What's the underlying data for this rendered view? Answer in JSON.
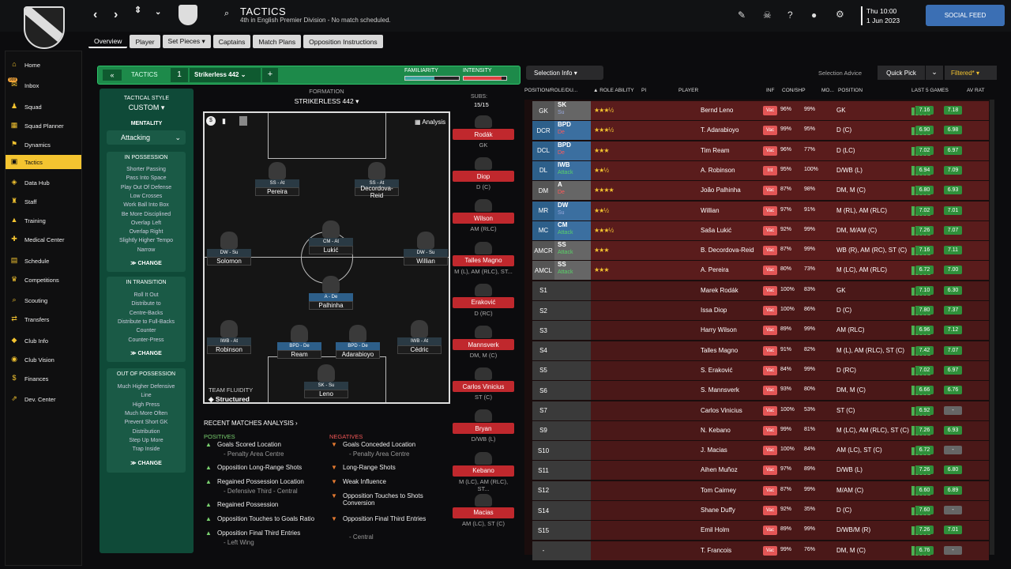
{
  "header": {
    "title": "TACTICS",
    "subtitle": "4th in English Premier Division - No match scheduled.",
    "time": "Thu 10:00",
    "date": "1 Jun 2023",
    "social_feed": "SOCIAL FEED"
  },
  "sidebar": [
    {
      "label": "Home",
      "icon": "home-icon"
    },
    {
      "label": "Inbox",
      "icon": "inbox-icon",
      "badge": "999"
    },
    {
      "label": "Squad",
      "icon": "squad-icon"
    },
    {
      "label": "Squad Planner",
      "icon": "planner-icon"
    },
    {
      "label": "Dynamics",
      "icon": "dynamics-icon"
    },
    {
      "label": "Tactics",
      "icon": "tactics-icon",
      "active": true
    },
    {
      "label": "Data Hub",
      "icon": "datahub-icon"
    },
    {
      "label": "Staff",
      "icon": "staff-icon"
    },
    {
      "label": "Training",
      "icon": "training-icon"
    },
    {
      "label": "Medical Center",
      "icon": "medical-icon"
    },
    {
      "label": "Schedule",
      "icon": "schedule-icon"
    },
    {
      "label": "Competitions",
      "icon": "trophy-icon"
    },
    {
      "label": "Scouting",
      "icon": "scouting-icon"
    },
    {
      "label": "Transfers",
      "icon": "transfers-icon"
    },
    {
      "label": "Club Info",
      "icon": "clubinfo-icon"
    },
    {
      "label": "Club Vision",
      "icon": "vision-icon"
    },
    {
      "label": "Finances",
      "icon": "finances-icon"
    },
    {
      "label": "Dev. Center",
      "icon": "devcenter-icon"
    }
  ],
  "tabs": [
    "Overview",
    "Player",
    "Set Pieces ▾",
    "Captains",
    "Match Plans",
    "Opposition Instructions"
  ],
  "tactic_bar": {
    "label": "TACTICS",
    "slot": "1",
    "name": "Strikerless 442",
    "familiarity": "FAMILIARITY",
    "intensity": "INTENSITY"
  },
  "style": {
    "heading": "TACTICAL STYLE",
    "value": "CUSTOM ▾",
    "mentality_label": "MENTALITY",
    "mentality": "Attacking",
    "in_possession": {
      "title": "IN POSSESSION",
      "items": [
        "Shorter Passing",
        "Pass Into Space",
        "Play Out Of Defense",
        "Low Crosses",
        "Work Ball Into Box",
        "Be More Disciplined",
        "Overlap Left",
        "Overlap Right",
        "Slightly Higher Tempo",
        "Narrow"
      ]
    },
    "in_transition": {
      "title": "IN TRANSITION",
      "items": [
        "Roll It Out",
        "Distribute to",
        "Centre-Backs",
        "Distribute to Full-Backs",
        "Counter",
        "Counter-Press"
      ]
    },
    "out_of_possession": {
      "title": "OUT OF POSSESSION",
      "items": [
        "Much Higher Defensive",
        "Line",
        "High Press",
        "Much More Often",
        "Prevent Short GK",
        "Distribution",
        "Step Up More",
        "Trap Inside"
      ]
    },
    "change": "CHANGE"
  },
  "formation": {
    "label": "FORMATION",
    "name": "STRIKERLESS 442 ▾",
    "analysis": "Analysis",
    "fluidity_label": "TEAM FLUIDITY",
    "fluidity": "Structured"
  },
  "pitch_players": [
    {
      "role": "SS - At",
      "name": "Pereira"
    },
    {
      "role": "SS - At",
      "name": "Decordova-Reid"
    },
    {
      "role": "DW - Su",
      "name": "Solomon"
    },
    {
      "role": "CM - At",
      "name": "Lukić"
    },
    {
      "role": "DW - Su",
      "name": "Willian"
    },
    {
      "role": "A - De",
      "name": "Palhinha"
    },
    {
      "role": "IWB - At",
      "name": "Robinson"
    },
    {
      "role": "BPD - De",
      "name": "Ream"
    },
    {
      "role": "BPD - De",
      "name": "Adarabioyo"
    },
    {
      "role": "IWB - At",
      "name": "Cédric"
    },
    {
      "role": "SK - Su",
      "name": "Leno"
    }
  ],
  "subs": {
    "label": "SUBS:",
    "count": "15/15",
    "players": [
      {
        "name": "Rodák",
        "pos": "GK"
      },
      {
        "name": "Diop",
        "pos": "D (C)"
      },
      {
        "name": "Wilson",
        "pos": "AM (RLC)"
      },
      {
        "name": "Talles Magno",
        "pos": "M (L), AM (RLC), ST..."
      },
      {
        "name": "Eraković",
        "pos": "D (RC)"
      },
      {
        "name": "Mannsverk",
        "pos": "DM, M (C)"
      },
      {
        "name": "Carlos Vinicius",
        "pos": "ST (C)"
      },
      {
        "name": "Bryan",
        "pos": "D/WB (L)"
      },
      {
        "name": "Kebano",
        "pos": "M (LC), AM (RLC), ST..."
      },
      {
        "name": "Macias",
        "pos": "AM (LC), ST (C)"
      }
    ]
  },
  "analysis": {
    "title": "RECENT MATCHES ANALYSIS ›",
    "positives_label": "POSITIVES",
    "negatives_label": "NEGATIVES",
    "positives": [
      {
        "t": "Goals Scored Location",
        "s": "- Penalty Area Centre"
      },
      {
        "t": "Opposition Long-Range Shots",
        "s": ""
      },
      {
        "t": "Regained Possession Location",
        "s": "- Defensive Third - Central"
      },
      {
        "t": "Regained Possession",
        "s": ""
      },
      {
        "t": "Opposition Touches to Goals Ratio",
        "s": ""
      },
      {
        "t": "Opposition Final Third Entries",
        "s": "- Left Wing"
      }
    ],
    "negatives": [
      {
        "t": "Goals Conceded Location",
        "s": "- Penalty Area Centre"
      },
      {
        "t": "Long-Range Shots",
        "s": ""
      },
      {
        "t": "Weak Influence",
        "s": ""
      },
      {
        "t": "Opposition Touches to Shots Conversion",
        "s": ""
      },
      {
        "t": "Opposition Final Third Entries",
        "s": "- Central"
      }
    ]
  },
  "selection": {
    "info": "Selection Info ▾",
    "advice": "Selection Advice",
    "quick_pick": "Quick Pick",
    "filtered": "Filtered* ▾",
    "columns": [
      "POSITION/ROLE/DU...",
      "▲ ROLE ABILITY",
      "PI",
      "PLAYER",
      "INF",
      "CON/SHP",
      "MO...",
      "POSITION",
      "LAST 5 GAMES",
      "AV RAT"
    ]
  },
  "rows": [
    {
      "pos": "GK",
      "role": "SK",
      "duty": "Su",
      "stars": "★★★½",
      "player": "Bernd Leno",
      "inf": "Vac",
      "con": "96%",
      "shp": "99%",
      "position": "GK",
      "form": [
        8,
        10,
        8,
        10,
        9
      ],
      "r1": "7.16",
      "r2": "7.18"
    },
    {
      "pos": "DCR",
      "role": "BPD",
      "duty": "De",
      "stars": "★★★½",
      "player": "T. Adarabioyo",
      "inf": "Vac",
      "con": "99%",
      "shp": "95%",
      "position": "D (C)",
      "form": [
        8,
        9,
        10,
        8,
        9
      ],
      "r1": "6.90",
      "r2": "6.98"
    },
    {
      "pos": "DCL",
      "role": "BPD",
      "duty": "De",
      "stars": "★★★",
      "player": "Tim Ream",
      "inf": "Vac",
      "con": "96%",
      "shp": "77%",
      "position": "D (LC)",
      "form": [
        9,
        8,
        10,
        9,
        8
      ],
      "r1": "7.02",
      "r2": "6.97"
    },
    {
      "pos": "DL",
      "role": "IWB",
      "duty": "Attack",
      "stars": "★★½",
      "player": "A. Robinson",
      "inf": "Int",
      "con": "95%",
      "shp": "100%",
      "position": "D/WB (L)",
      "form": [
        10,
        9,
        8,
        10,
        9
      ],
      "r1": "6.94",
      "r2": "7.09"
    },
    {
      "pos": "DM",
      "role": "A",
      "duty": "De",
      "stars": "★★★★",
      "player": "João Palhinha",
      "inf": "Vac",
      "con": "87%",
      "shp": "98%",
      "position": "DM, M (C)",
      "form": [
        9,
        10,
        9,
        8,
        10
      ],
      "r1": "6.80",
      "r2": "6.93"
    },
    {
      "pos": "MR",
      "role": "DW",
      "duty": "Su",
      "stars": "★★½",
      "player": "Willian",
      "inf": "Vac",
      "con": "97%",
      "shp": "91%",
      "position": "M (RL), AM (RLC)",
      "form": [
        10,
        9,
        10,
        8,
        9
      ],
      "r1": "7.02",
      "r2": "7.01"
    },
    {
      "pos": "MC",
      "role": "CM",
      "duty": "Attack",
      "stars": "★★★½",
      "player": "Saša Lukić",
      "inf": "Vac",
      "con": "92%",
      "shp": "99%",
      "position": "DM, M/AM (C)",
      "form": [
        9,
        10,
        9,
        10,
        8
      ],
      "r1": "7.26",
      "r2": "7.07"
    },
    {
      "pos": "AMCR",
      "role": "SS",
      "duty": "Attack",
      "stars": "★★★",
      "player": "B. Decordova-Reid",
      "inf": "Vac",
      "con": "87%",
      "shp": "99%",
      "position": "WB (R), AM (RC), ST (C)",
      "form": [
        8,
        10,
        9,
        10,
        9
      ],
      "r1": "7.16",
      "r2": "7.11"
    },
    {
      "pos": "AMCL",
      "role": "SS",
      "duty": "Attack",
      "stars": "★★★",
      "player": "A. Pereira",
      "inf": "Vac",
      "con": "80%",
      "shp": "73%",
      "position": "M (LC), AM (RLC)",
      "form": [
        9,
        8,
        10,
        9,
        10
      ],
      "r1": "6.72",
      "r2": "7.00"
    },
    {
      "pos": "S1",
      "role": "",
      "duty": "",
      "stars": "",
      "player": "Marek Rodák",
      "inf": "Vac",
      "con": "100%",
      "shp": "83%",
      "position": "GK",
      "form": [
        8,
        9,
        10,
        9,
        8
      ],
      "r1": "7.10",
      "r2": "6.30"
    },
    {
      "pos": "S2",
      "role": "",
      "duty": "",
      "stars": "",
      "player": "Issa Diop",
      "inf": "Vac",
      "con": "100%",
      "shp": "86%",
      "position": "D (C)",
      "form": [
        9,
        10,
        8,
        9,
        10
      ],
      "r1": "7.80",
      "r2": "7.37"
    },
    {
      "pos": "S3",
      "role": "",
      "duty": "",
      "stars": "",
      "player": "Harry Wilson",
      "inf": "Vac",
      "con": "89%",
      "shp": "99%",
      "position": "AM (RLC)",
      "form": [
        10,
        8,
        9,
        10,
        9
      ],
      "r1": "6.96",
      "r2": "7.12"
    },
    {
      "pos": "S4",
      "role": "",
      "duty": "",
      "stars": "",
      "player": "Talles Magno",
      "inf": "Vac",
      "con": "91%",
      "shp": "82%",
      "position": "M (L), AM (RLC), ST (C)",
      "form": [
        9,
        9,
        10,
        8,
        10
      ],
      "r1": "7.42",
      "r2": "7.07"
    },
    {
      "pos": "S5",
      "role": "",
      "duty": "",
      "stars": "",
      "player": "S. Eraković",
      "inf": "Vac",
      "con": "84%",
      "shp": "99%",
      "position": "D (RC)",
      "form": [
        8,
        10,
        9,
        9,
        10
      ],
      "r1": "7.02",
      "r2": "6.97"
    },
    {
      "pos": "S6",
      "role": "",
      "duty": "",
      "stars": "",
      "player": "S. Mannsverk",
      "inf": "Vac",
      "con": "93%",
      "shp": "80%",
      "position": "DM, M (C)",
      "form": [
        10,
        9,
        8,
        10,
        9
      ],
      "r1": "6.66",
      "r2": "6.76"
    },
    {
      "pos": "S7",
      "role": "",
      "duty": "",
      "stars": "",
      "player": "Carlos Vinicius",
      "inf": "Vac",
      "con": "100%",
      "shp": "53%",
      "position": "ST (C)",
      "form": [
        9,
        8,
        10,
        9,
        8
      ],
      "r1": "6.92",
      "r2": "-"
    },
    {
      "pos": "S9",
      "role": "",
      "duty": "",
      "stars": "",
      "player": "N. Kebano",
      "inf": "Vac",
      "con": "99%",
      "shp": "81%",
      "position": "M (LC), AM (RLC), ST (C)",
      "form": [
        10,
        10,
        9,
        8,
        9
      ],
      "r1": "7.26",
      "r2": "6.93"
    },
    {
      "pos": "S10",
      "role": "",
      "duty": "",
      "stars": "",
      "player": "J. Macias",
      "inf": "Vac",
      "con": "100%",
      "shp": "84%",
      "position": "AM (LC), ST (C)",
      "form": [
        8,
        9,
        10,
        9,
        10
      ],
      "r1": "6.72",
      "r2": "-"
    },
    {
      "pos": "S11",
      "role": "",
      "duty": "",
      "stars": "",
      "player": "Aihen Muñoz",
      "inf": "Vac",
      "con": "97%",
      "shp": "89%",
      "position": "D/WB (L)",
      "form": [
        9,
        10,
        8,
        10,
        9
      ],
      "r1": "7.26",
      "r2": "6.80"
    },
    {
      "pos": "S12",
      "role": "",
      "duty": "",
      "stars": "",
      "player": "Tom Cairney",
      "inf": "Vac",
      "con": "87%",
      "shp": "99%",
      "position": "M/AM (C)",
      "form": [
        10,
        9,
        9,
        8,
        10
      ],
      "r1": "6.60",
      "r2": "6.89"
    },
    {
      "pos": "S14",
      "role": "",
      "duty": "",
      "stars": "",
      "player": "Shane Duffy",
      "inf": "Vac",
      "con": "92%",
      "shp": "35%",
      "position": "D (C)",
      "form": [
        8,
        10,
        9,
        10,
        8
      ],
      "r1": "7.60",
      "r2": "-"
    },
    {
      "pos": "S15",
      "role": "",
      "duty": "",
      "stars": "",
      "player": "Emil Holm",
      "inf": "Vac",
      "con": "89%",
      "shp": "99%",
      "position": "D/WB/M (R)",
      "form": [
        9,
        8,
        10,
        9,
        10
      ],
      "r1": "7.26",
      "r2": "7.01"
    },
    {
      "pos": "-",
      "role": "",
      "duty": "",
      "stars": "",
      "player": "T. Francois",
      "inf": "Vac",
      "con": "99%",
      "shp": "76%",
      "position": "DM, M (C)",
      "form": [
        10,
        9,
        8,
        9,
        9
      ],
      "r1": "6.76",
      "r2": "-"
    }
  ],
  "colors": {
    "accent": "#f4c430",
    "bg": "#0c0c0e",
    "green": "#1d8a4a",
    "red_row": "#5a1c1c",
    "sub_red": "#c0282d"
  }
}
